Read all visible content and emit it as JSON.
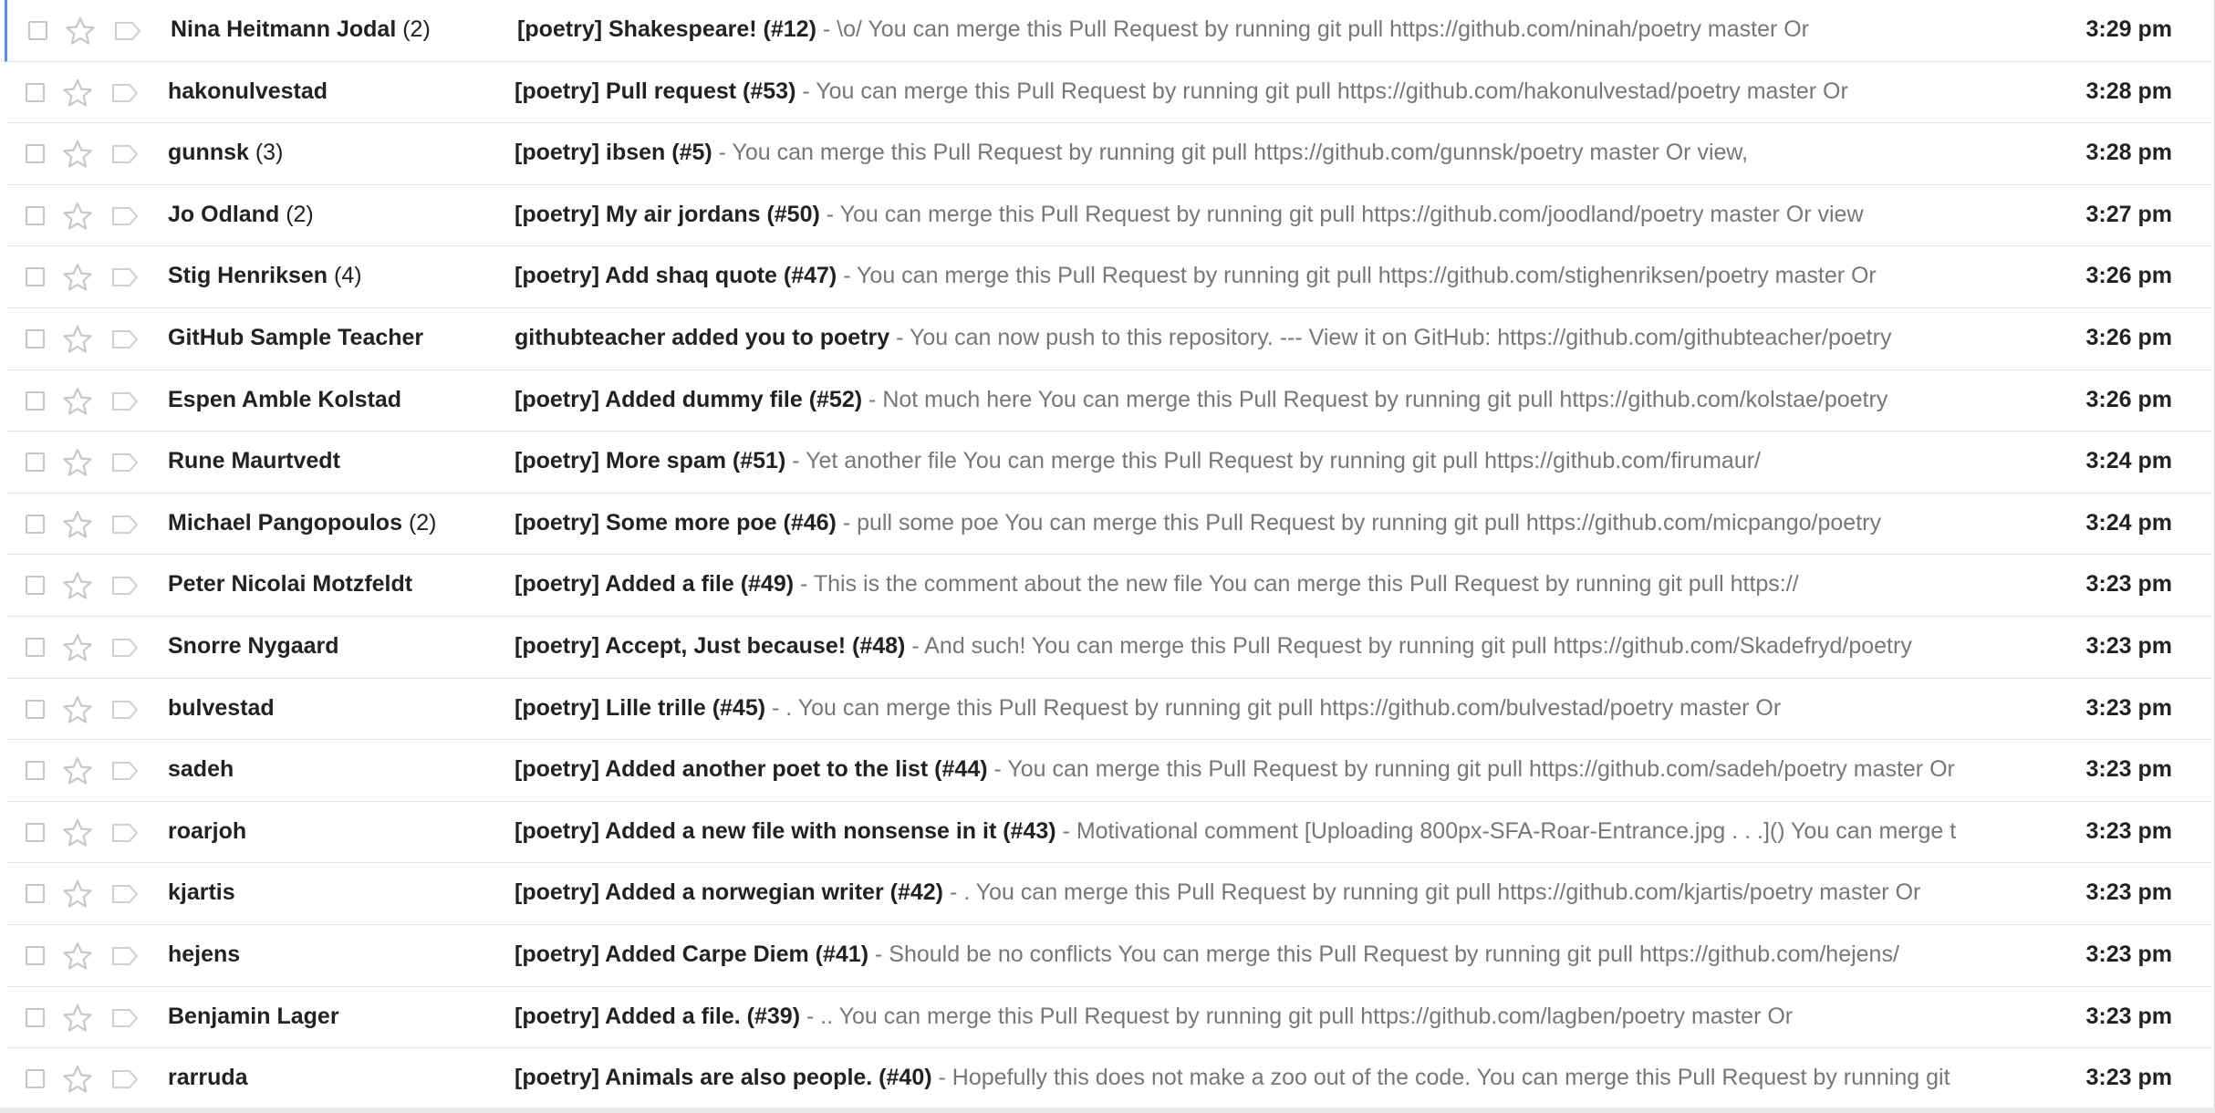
{
  "inbox": {
    "rows": [
      {
        "sender": "Nina Heitmann Jodal",
        "count": "(2)",
        "subject": "[poetry] Shakespeare! (#12)",
        "snippet": "\\o/ You can merge this Pull Request by running git pull https://github.com/ninah/poetry master Or",
        "time": "3:29 pm",
        "active": true
      },
      {
        "sender": "hakonulvestad",
        "count": "",
        "subject": "[poetry] Pull request (#53)",
        "snippet": "You can merge this Pull Request by running git pull https://github.com/hakonulvestad/poetry master Or",
        "time": "3:28 pm"
      },
      {
        "sender": "gunnsk",
        "count": "(3)",
        "subject": "[poetry] ibsen (#5)",
        "snippet": "You can merge this Pull Request by running git pull https://github.com/gunnsk/poetry master Or view,",
        "time": "3:28 pm"
      },
      {
        "sender": "Jo Odland",
        "count": "(2)",
        "subject": "[poetry] My air jordans (#50)",
        "snippet": "You can merge this Pull Request by running git pull https://github.com/joodland/poetry master Or view",
        "time": "3:27 pm"
      },
      {
        "sender": "Stig Henriksen",
        "count": "(4)",
        "subject": "[poetry] Add shaq quote (#47)",
        "snippet": "You can merge this Pull Request by running git pull https://github.com/stighenriksen/poetry master Or",
        "time": "3:26 pm"
      },
      {
        "sender": "GitHub Sample Teacher",
        "count": "",
        "subject": "githubteacher added you to poetry",
        "snippet": "You can now push to this repository. --- View it on GitHub: https://github.com/githubteacher/poetry",
        "time": "3:26 pm"
      },
      {
        "sender": "Espen Amble Kolstad",
        "count": "",
        "subject": "[poetry] Added dummy file (#52)",
        "snippet": "Not much here You can merge this Pull Request by running git pull https://github.com/kolstae/poetry",
        "time": "3:26 pm"
      },
      {
        "sender": "Rune Maurtvedt",
        "count": "",
        "subject": "[poetry] More spam (#51)",
        "snippet": "Yet another file You can merge this Pull Request by running git pull https://github.com/firumaur/",
        "time": "3:24 pm"
      },
      {
        "sender": "Michael Pangopoulos",
        "count": "(2)",
        "subject": "[poetry] Some more poe (#46)",
        "snippet": "pull some poe You can merge this Pull Request by running git pull https://github.com/micpango/poetry",
        "time": "3:24 pm"
      },
      {
        "sender": "Peter Nicolai Motzfeldt",
        "count": "",
        "subject": "[poetry] Added a file (#49)",
        "snippet": "This is the comment about the new file You can merge this Pull Request by running git pull https://",
        "time": "3:23 pm"
      },
      {
        "sender": "Snorre Nygaard",
        "count": "",
        "subject": "[poetry] Accept, Just because! (#48)",
        "snippet": "And such! You can merge this Pull Request by running git pull https://github.com/Skadefryd/poetry",
        "time": "3:23 pm"
      },
      {
        "sender": "bulvestad",
        "count": "",
        "subject": "[poetry] Lille trille (#45)",
        "snippet": ". You can merge this Pull Request by running git pull https://github.com/bulvestad/poetry master Or",
        "time": "3:23 pm"
      },
      {
        "sender": "sadeh",
        "count": "",
        "subject": "[poetry] Added another poet to the list (#44)",
        "snippet": "You can merge this Pull Request by running git pull https://github.com/sadeh/poetry master Or",
        "time": "3:23 pm"
      },
      {
        "sender": "roarjoh",
        "count": "",
        "subject": "[poetry] Added a new file with nonsense in it (#43)",
        "snippet": "Motivational comment [Uploading 800px-SFA-Roar-Entrance.jpg . . .]() You can merge t",
        "time": "3:23 pm"
      },
      {
        "sender": "kjartis",
        "count": "",
        "subject": "[poetry] Added a norwegian writer (#42)",
        "snippet": ". You can merge this Pull Request by running git pull https://github.com/kjartis/poetry master Or",
        "time": "3:23 pm"
      },
      {
        "sender": "hejens",
        "count": "",
        "subject": "[poetry] Added Carpe Diem (#41)",
        "snippet": "Should be no conflicts You can merge this Pull Request by running git pull https://github.com/hejens/",
        "time": "3:23 pm"
      },
      {
        "sender": "Benjamin Lager",
        "count": "",
        "subject": "[poetry] Added a file. (#39)",
        "snippet": ".. You can merge this Pull Request by running git pull https://github.com/lagben/poetry master Or",
        "time": "3:23 pm"
      },
      {
        "sender": "rarruda",
        "count": "",
        "subject": "[poetry] Animals are also people. (#40)",
        "snippet": "Hopefully this does not make a zoo out of the code. You can merge this Pull Request by running git",
        "time": "3:23 pm"
      }
    ],
    "separator": "-",
    "icons": {
      "checkbox": "checkbox-icon",
      "star": "star-icon",
      "importance": "importance-marker-icon"
    },
    "colors": {
      "active_marker": "#4d90fe",
      "snippet": "#777777",
      "border": "#e4e4e4"
    }
  }
}
